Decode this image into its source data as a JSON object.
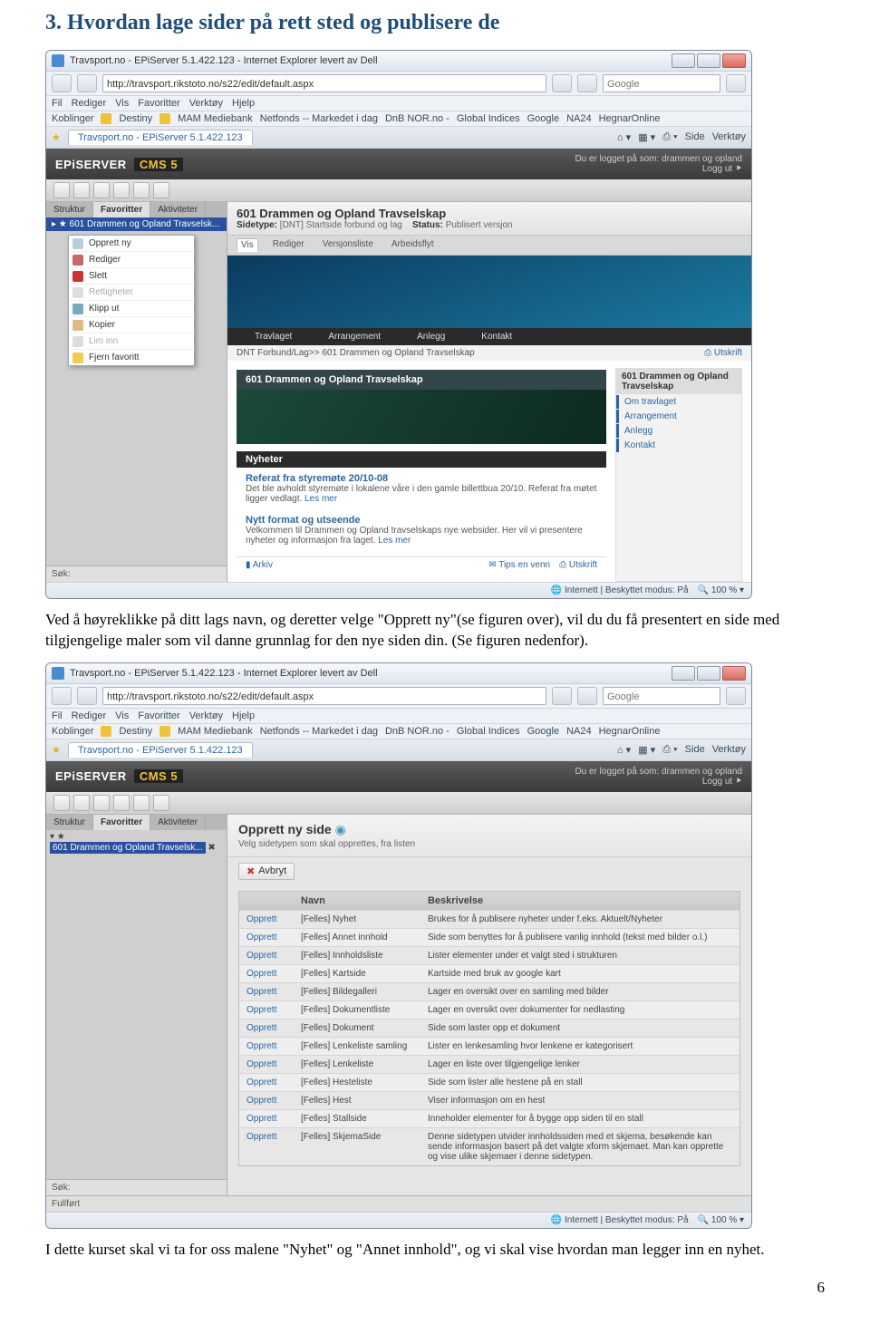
{
  "section_title": "3. Hvordan lage sider på rett sted og publisere de",
  "para1": "Ved å høyreklikke på ditt lags navn, og deretter velge \"Opprett ny\"(se figuren over), vil du du få presentert en side med tilgjengelige maler som vil danne grunnlag for den nye siden din. (Se figuren nedenfor).",
  "para2": "I dette kurset skal vi ta for oss malene \"Nyhet\" og \"Annet innhold\", og vi skal vise hvordan man legger inn en nyhet.",
  "page_number": "6",
  "browser": {
    "window_title": "Travsport.no - EPiServer 5.1.422.123 - Internet Explorer levert av Dell",
    "url": "http://travsport.rikstoto.no/s22/edit/default.aspx",
    "search_placeholder": "Google",
    "menu": [
      "Fil",
      "Rediger",
      "Vis",
      "Favoritter",
      "Verktøy",
      "Hjelp"
    ],
    "links_label": "Koblinger",
    "link_items": [
      "Destiny",
      "MAM Mediebank",
      "Netfonds -- Markedet i dag",
      "DnB NOR.no -",
      "Global Indices",
      "Google",
      "NA24",
      "HegnarOnline"
    ],
    "tab_label": "Travsport.no - EPiServer 5.1.422.123",
    "toolbar_right": [
      "Side",
      "Verktøy"
    ],
    "status_center": "Internett | Beskyttet modus: På",
    "zoom": "100 %"
  },
  "epi": {
    "logo": "EPiSERVER",
    "cms": "CMS 5",
    "logged_in_label": "Du er logget på som:",
    "logged_user": "drammen og opland",
    "logout": "Logg ut",
    "left_tabs": [
      "Struktur",
      "Favoritter",
      "Aktiviteter"
    ],
    "tree_item": "601 Drammen og Opland Travselsk...",
    "context_menu": [
      "Opprett ny",
      "Rediger",
      "Slett",
      "Rettigheter",
      "Klipp ut",
      "Kopier",
      "Lim inn",
      "Fjern favoritt"
    ],
    "disabled_items": [
      "Rettigheter",
      "Lim inn"
    ],
    "sok_label": "Søk:"
  },
  "page1": {
    "title": "601 Drammen og Opland Travselskap",
    "sidetype_label": "Sidetype:",
    "sidetype_val": "[DNT] Startside forbund og lag",
    "status_label": "Status:",
    "status_val": "Publisert versjon",
    "action_tabs": [
      "Vis",
      "Rediger",
      "Versjonsliste",
      "Arbeidsflyt"
    ],
    "nav": [
      "Travlaget",
      "Arrangement",
      "Anlegg",
      "Kontakt"
    ],
    "breadcrumb": "DNT Forbund/Lag>>  601 Drammen og Opland Travselskap",
    "utskrift": "Utskrift",
    "sidebox_head": "601 Drammen og Opland Travselskap",
    "sidebox_items": [
      "Om travlaget",
      "Arrangement",
      "Anlegg",
      "Kontakt"
    ],
    "band_title": "601 Drammen og Opland Travselskap",
    "news_head": "Nyheter",
    "news": [
      {
        "title": "Referat fra styremøte 20/10-08",
        "text": "Det ble avholdt styremøte i lokalene våre i den gamle billettbua 20/10. Referat fra møtet ligger vedlagt.",
        "more": "Les mer"
      },
      {
        "title": "Nytt format og utseende",
        "text": "Velkommen til Drammen og Opland travselskaps nye websider. Her vil vi presentere nyheter og informasjon fra laget.",
        "more": "Les mer"
      }
    ],
    "arkiv": "Arkiv",
    "footer_left": "Tips en venn",
    "footer_right": "Utskrift"
  },
  "page2": {
    "title": "Opprett ny side",
    "subtitle": "Velg sidetypen som skal opprettes, fra listen",
    "cancel": "Avbryt",
    "table_head": [
      "",
      "Navn",
      "Beskrivelse"
    ],
    "rows": [
      {
        "name": "[Felles] Nyhet",
        "desc": "Brukes for å publisere nyheter under f.eks. Aktuelt/Nyheter"
      },
      {
        "name": "[Felles] Annet innhold",
        "desc": "Side som benyttes for å publisere vanlig innhold (tekst med bilder o.l.)"
      },
      {
        "name": "[Felles] Innholdsliste",
        "desc": "Lister elementer under et valgt sted i strukturen"
      },
      {
        "name": "[Felles] Kartside",
        "desc": "Kartside med bruk av google kart"
      },
      {
        "name": "[Felles] Bildegalleri",
        "desc": "Lager en oversikt over en samling med bilder"
      },
      {
        "name": "[Felles] Dokumentliste",
        "desc": "Lager en oversikt over dokumenter for nedlasting"
      },
      {
        "name": "[Felles] Dokument",
        "desc": "Side som laster opp et dokument"
      },
      {
        "name": "[Felles] Lenkeliste samling",
        "desc": "Lister en lenkesamling hvor lenkene er kategorisert"
      },
      {
        "name": "[Felles] Lenkeliste",
        "desc": "Lager en liste over tilgjengelige lenker"
      },
      {
        "name": "[Felles] Hesteliste",
        "desc": "Side som lister alle hestene på en stall"
      },
      {
        "name": "[Felles] Hest",
        "desc": "Viser informasjon om en hest"
      },
      {
        "name": "[Felles] Stallside",
        "desc": "Inneholder elementer for å bygge opp siden til en stall"
      },
      {
        "name": "[Felles] SkjemaSide",
        "desc": "Denne sidetypen utvider innholdssiden med et skjema, besøkende kan sende informasjon basert på det valgte xform skjemaet. Man kan opprette og vise ulike skjemaer i denne sidetypen."
      }
    ],
    "opprett": "Opprett",
    "fullfort": "Fullført"
  }
}
